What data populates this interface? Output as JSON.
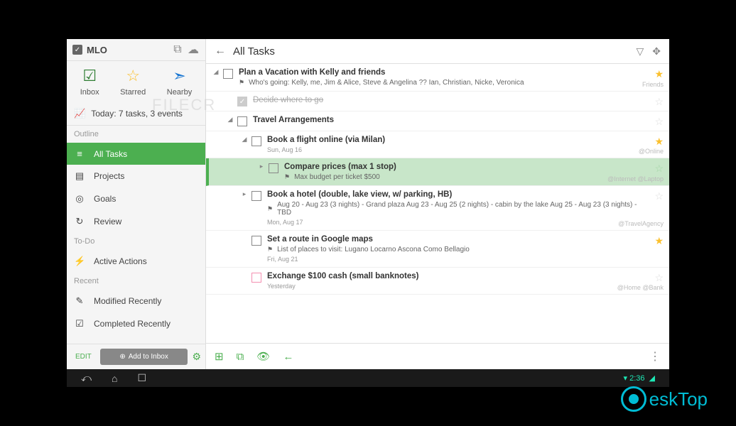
{
  "sidebar": {
    "app_name": "MLO",
    "watermark": "FILECR",
    "tabs": {
      "inbox": "Inbox",
      "starred": "Starred",
      "nearby": "Nearby"
    },
    "today": "Today: 7 tasks, 3 events",
    "sections": {
      "outline": "Outline",
      "todo": "To-Do",
      "recent": "Recent"
    },
    "nav": {
      "all_tasks": "All Tasks",
      "projects": "Projects",
      "goals": "Goals",
      "review": "Review",
      "active_actions": "Active Actions",
      "modified_recently": "Modified Recently",
      "completed_recently": "Completed Recently"
    },
    "footer": {
      "edit": "EDIT",
      "add_inbox": "Add to Inbox"
    }
  },
  "main": {
    "title": "All Tasks",
    "tasks": [
      {
        "title": "Plan a Vacation with Kelly and friends",
        "sub": "Who's going: Kelly, me, Jim & Alice, Steve & Angelina ?? Ian, Christian, Nicke, Veronica",
        "tag": "Friends",
        "indent": 0,
        "expanded": true,
        "star": true
      },
      {
        "title": "Decide where to go",
        "indent": 1,
        "done": true,
        "star": false
      },
      {
        "title": "Travel Arrangements",
        "indent": 1,
        "expanded": true,
        "star": false
      },
      {
        "title": "Book a flight online (via Milan)",
        "date": "Sun, Aug 16",
        "tag": "@Online",
        "indent": 2,
        "expanded": true,
        "star": true
      },
      {
        "title": "Compare prices (max 1 stop)",
        "sub": "Max budget per ticket $500",
        "tag": "@Internet  @Laptop",
        "indent": 3,
        "hl": true,
        "expander": true
      },
      {
        "title": "Book a hotel (double, lake view, w/ parking, HB)",
        "sub": "Aug 20 - Aug 23 (3 nights) - Grand plaza Aug 23 - Aug 25 (2 nights) - cabin by the lake Aug 25 - Aug 23 (3 nights) - TBD",
        "date": "Mon, Aug 17",
        "tag": "@TravelAgency",
        "indent": 2,
        "expander": true,
        "star": false
      },
      {
        "title": "Set a route in Google maps",
        "sub": "List of places to visit: Lugano Locarno Ascona Como Bellagio",
        "date": "Fri, Aug 21",
        "indent": 2,
        "star": true
      },
      {
        "title": "Exchange $100 cash (small banknotes)",
        "date": "Yesterday",
        "tag": "@Home  @Bank",
        "indent": 2,
        "star": false,
        "pink": true
      }
    ]
  },
  "desktop_logo": "eskTop"
}
